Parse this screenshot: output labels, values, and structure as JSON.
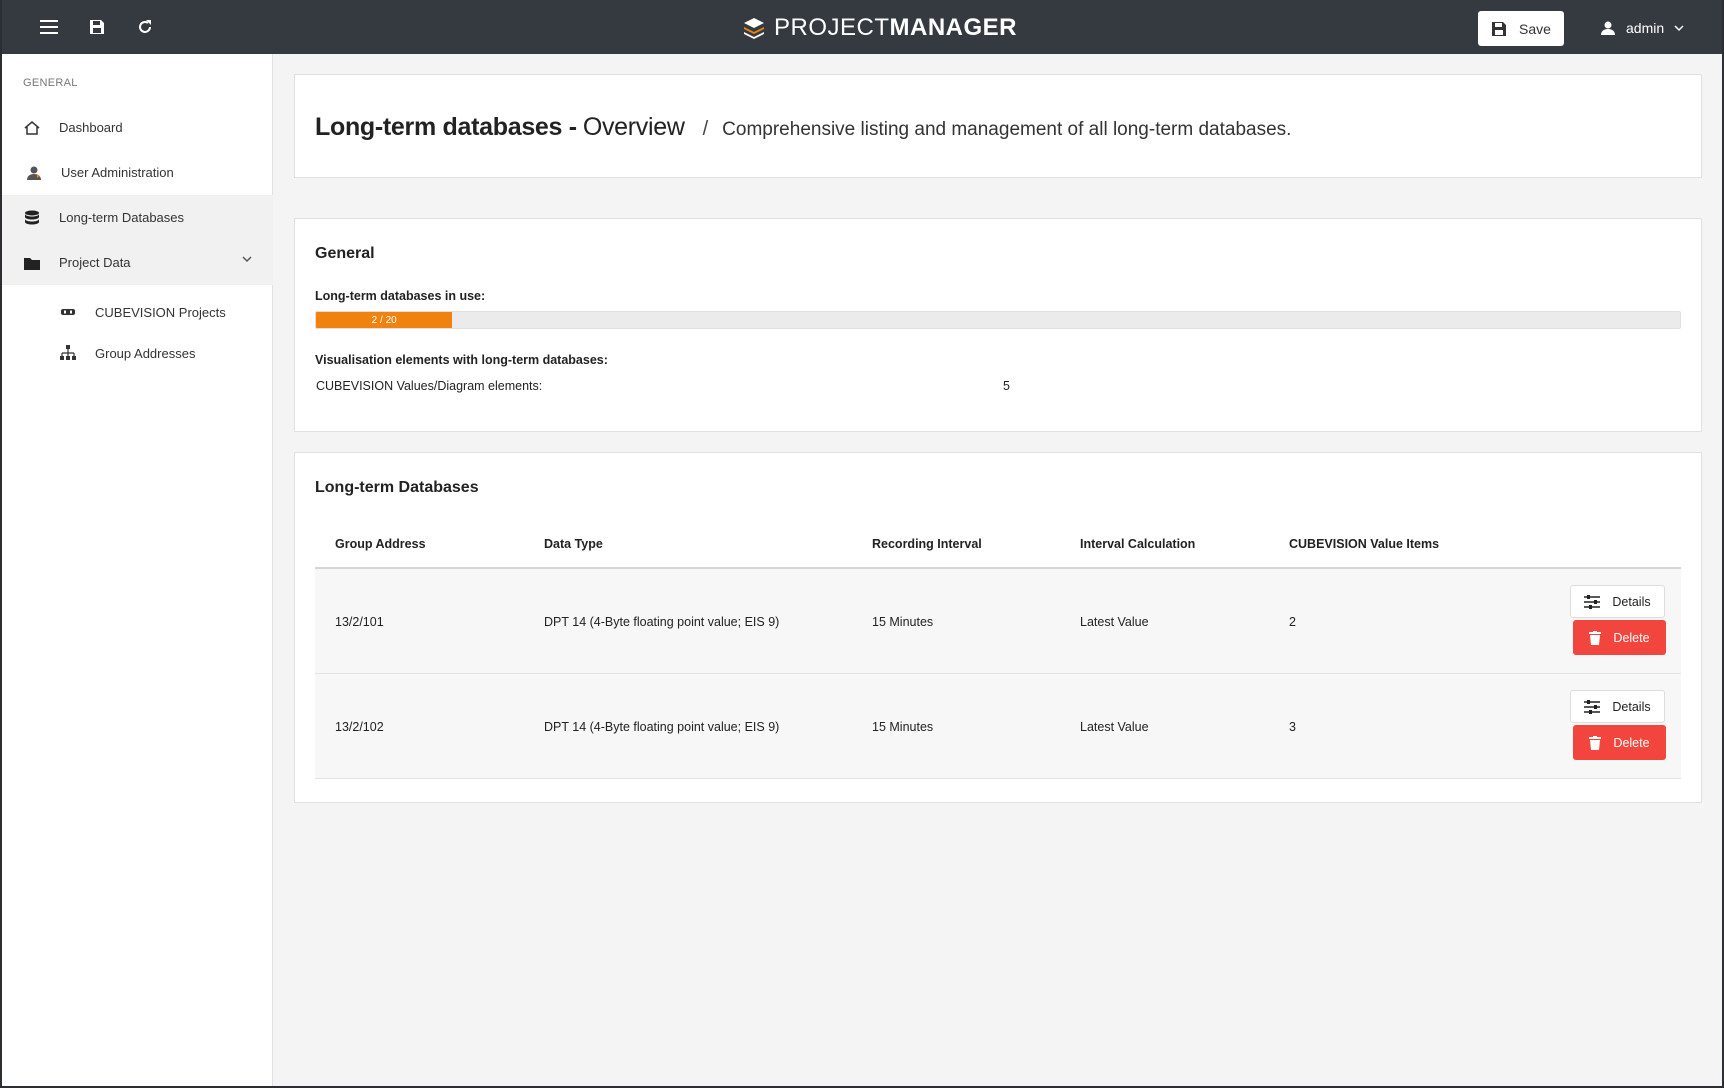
{
  "app": {
    "brand_light": "PROJECT",
    "brand_bold": "MANAGER",
    "save_label": "Save",
    "user_name": "admin"
  },
  "sidebar": {
    "section": "GENERAL",
    "items": [
      {
        "label": "Dashboard",
        "icon": "home-icon"
      },
      {
        "label": "User Administration",
        "icon": "user-admin-icon"
      },
      {
        "label": "Long-term Databases",
        "icon": "database-icon",
        "active": true
      },
      {
        "label": "Project Data",
        "icon": "folder-icon",
        "expanded": true
      }
    ],
    "subitems": [
      {
        "label": "CUBEVISION Projects",
        "icon": "cubevision-icon"
      },
      {
        "label": "Group Addresses",
        "icon": "sitemap-icon"
      }
    ]
  },
  "page": {
    "title_bold": "Long-term databases -",
    "title_light": "Overview",
    "separator": "/",
    "description": "Comprehensive listing and management of all long-term databases."
  },
  "general": {
    "heading": "General",
    "in_use_label": "Long-term databases in use:",
    "progress_text": "2 / 20",
    "progress_fraction": 0.1,
    "vis_label": "Visualisation elements with long-term databases:",
    "cv_label": "CUBEVISION Values/Diagram elements:",
    "cv_value": "5"
  },
  "databases": {
    "heading": "Long-term Databases",
    "columns": [
      "Group Address",
      "Data Type",
      "Recording Interval",
      "Interval Calculation",
      "CUBEVISION Value Items"
    ],
    "rows": [
      {
        "group_address": "13/2/101",
        "data_type": "DPT 14 (4-Byte floating point value; EIS 9)",
        "interval": "15 Minutes",
        "calculation": "Latest Value",
        "items": "2"
      },
      {
        "group_address": "13/2/102",
        "data_type": "DPT 14 (4-Byte floating point value; EIS 9)",
        "interval": "15 Minutes",
        "calculation": "Latest Value",
        "items": "3"
      }
    ],
    "details_label": "Details",
    "delete_label": "Delete"
  },
  "colors": {
    "topbar": "#343a40",
    "accent_orange": "#f2820f",
    "danger": "#f2453d"
  }
}
